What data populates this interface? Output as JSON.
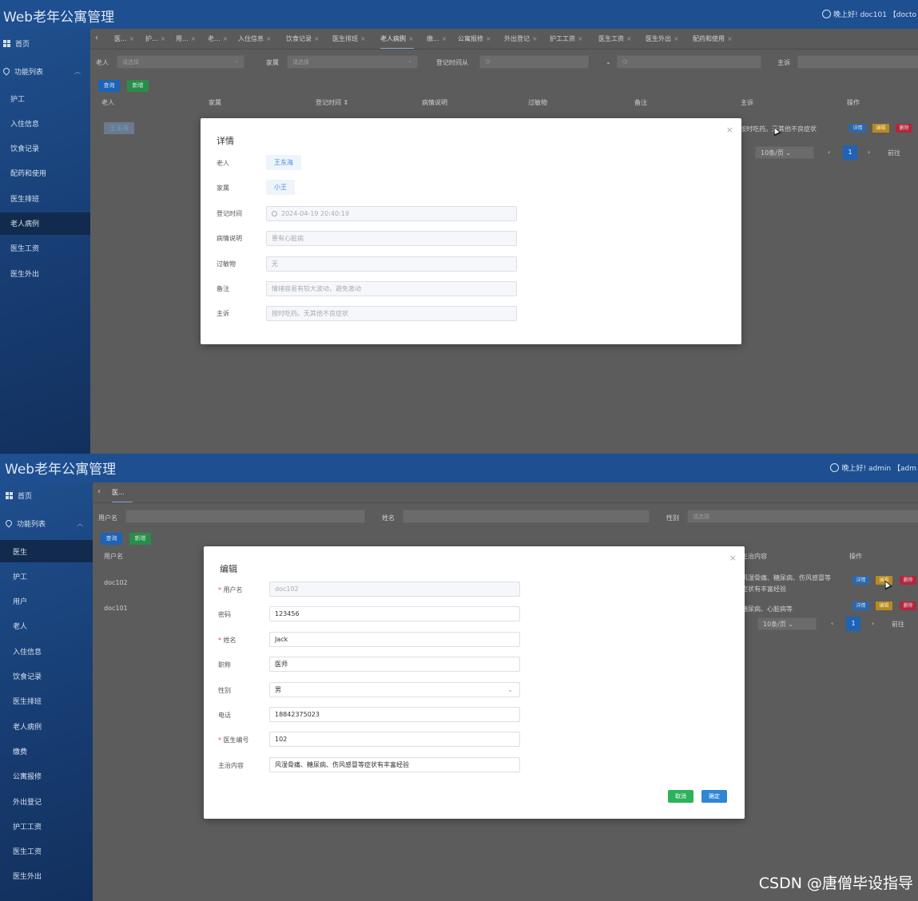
{
  "shot1": {
    "app_title": "Web老年公寓管理",
    "user_text": "晚上好! doc101 【docto",
    "sidebar": {
      "home": "首页",
      "func": "功能列表",
      "items": [
        "护工",
        "入住信息",
        "饮食记录",
        "配药和使用",
        "医生排班",
        "老人病例",
        "医生工资",
        "医生外出"
      ],
      "active_index": 5
    },
    "tabs": [
      "医...",
      "护...",
      "用...",
      "老...",
      "入住信息",
      "饮食记录",
      "医生排班",
      "老人病例",
      "缴...",
      "公寓报修",
      "外出登记",
      "护工工资",
      "医生工资",
      "医生外出",
      "配药和使用"
    ],
    "active_tab": 7,
    "filters": {
      "elder_label": "老人",
      "elder_placeholder": "请选择",
      "family_label": "家属",
      "family_placeholder": "请选择",
      "time_label": "登记时间从",
      "complaint_label": "主诉"
    },
    "buttons": {
      "query": "查询",
      "add": "新增"
    },
    "table_headers": [
      "老人",
      "家属",
      "登记时间 ⇕",
      "病情说明",
      "过敏物",
      "备注",
      "主诉",
      "操作"
    ],
    "row": {
      "elder": "王东海",
      "complaint": "按时吃药。无其他不良症状"
    },
    "row_buttons": {
      "detail": "详情",
      "edit": "编辑",
      "delete": "删除"
    },
    "pager": {
      "size": "10条/页",
      "prev": "‹",
      "page": "1",
      "next": "›",
      "goto": "前往"
    },
    "modal": {
      "title": "详情",
      "close": "×",
      "fields": [
        {
          "label": "老人",
          "value": "王东海"
        },
        {
          "label": "家属",
          "value": "小王"
        },
        {
          "label": "登记时间",
          "value": "2024-04-19 20:40:19"
        },
        {
          "label": "病情说明",
          "value": "患有心脏病"
        },
        {
          "label": "过敏物",
          "value": "无"
        },
        {
          "label": "备注",
          "value": "情绪容易有较大波动，避免激动"
        },
        {
          "label": "主诉",
          "value": "按时吃药。无其他不良症状"
        }
      ]
    }
  },
  "shot2": {
    "app_title": "Web老年公寓管理",
    "user_text": "晚上好! admin 【adm",
    "sidebar": {
      "home": "首页",
      "func": "功能列表",
      "items": [
        "医生",
        "护工",
        "用户",
        "老人",
        "入住信息",
        "饮食记录",
        "医生排班",
        "老人病例",
        "缴费",
        "公寓报修",
        "外出登记",
        "护工工资",
        "医生工资",
        "医生外出"
      ],
      "active_index": 0
    },
    "tabs": [
      "医..."
    ],
    "filters": {
      "username_label": "用户名",
      "name_label": "姓名",
      "gender_label": "性别",
      "gender_placeholder": "请选择"
    },
    "buttons": {
      "query": "查询",
      "add": "新增"
    },
    "table_headers": [
      "用户名",
      "主治内容",
      "操作"
    ],
    "rows": [
      {
        "username": "doc102",
        "treat": "风湿骨痛、糖尿病、伤风感冒等症状有丰富经验"
      },
      {
        "username": "doc101",
        "treat": "糖尿病、心脏病等"
      }
    ],
    "row_buttons": {
      "detail": "详情",
      "edit": "编辑",
      "delete": "删除"
    },
    "pager": {
      "size": "10条/页",
      "prev": "‹",
      "page": "1",
      "next": "›",
      "goto": "前往"
    },
    "modal": {
      "title": "编辑",
      "close": "×",
      "fields": [
        {
          "label": "用户名",
          "required": true,
          "value": "doc102",
          "disabled": true
        },
        {
          "label": "密码",
          "required": false,
          "value": "123456"
        },
        {
          "label": "姓名",
          "required": true,
          "value": "Jack"
        },
        {
          "label": "职称",
          "required": false,
          "value": "医师"
        },
        {
          "label": "性别",
          "required": false,
          "value": "男",
          "select": true
        },
        {
          "label": "电话",
          "required": false,
          "value": "18842375023"
        },
        {
          "label": "医生编号",
          "required": true,
          "value": "102"
        },
        {
          "label": "主治内容",
          "required": false,
          "value": "风湿骨痛、糖尿病、伤风感冒等症状有丰富经验"
        }
      ],
      "cancel": "取消",
      "confirm": "确定"
    }
  },
  "watermark": "CSDN @唐僧毕设指导"
}
